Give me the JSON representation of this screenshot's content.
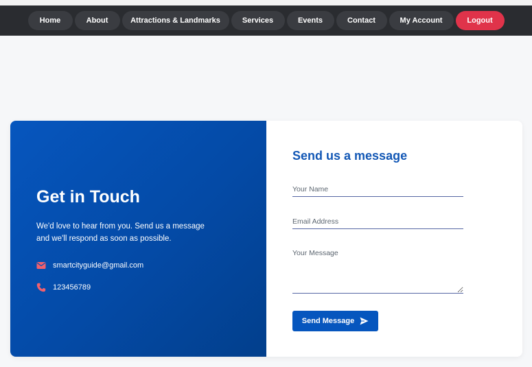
{
  "nav": {
    "items": [
      {
        "label": "Home"
      },
      {
        "label": "About"
      },
      {
        "label": "Attractions & Landmarks"
      },
      {
        "label": "Services"
      },
      {
        "label": "Events"
      },
      {
        "label": "Contact"
      },
      {
        "label": "My Account"
      },
      {
        "label": "Logout"
      }
    ]
  },
  "contact": {
    "title": "Get in Touch",
    "description": "We'd love to hear from you. Send us a message and we'll respond as soon as possible.",
    "email": "smartcityguide@gmail.com",
    "phone": "123456789",
    "email_icon": "envelope-icon",
    "phone_icon": "phone-icon"
  },
  "form": {
    "title": "Send us a message",
    "name_placeholder": "Your Name",
    "email_placeholder": "Email Address",
    "message_placeholder": "Your Message",
    "name_value": "",
    "email_value": "",
    "message_value": "",
    "submit_label": "Send Message",
    "submit_icon": "paper-plane-icon"
  },
  "colors": {
    "navbar_bg": "#2a2c30",
    "nav_pill": "#3a3c41",
    "logout": "#e0334a",
    "primary": "#0656be",
    "icon_accent": "#f0606e"
  }
}
